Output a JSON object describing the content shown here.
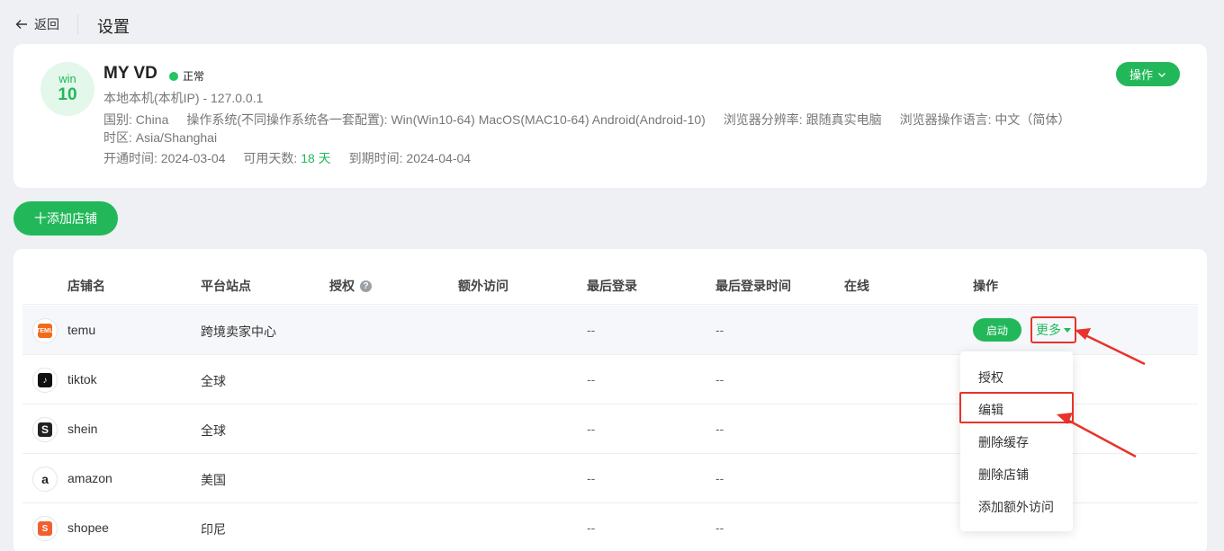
{
  "header": {
    "back_label": "返回",
    "title": "设置"
  },
  "device": {
    "os_label": "win",
    "os_version": "10",
    "name": "MY VD",
    "status": "正常",
    "status_color": "#22c55e",
    "address": "本地本机(本机IP) - 127.0.0.1",
    "country": "国别: China",
    "os_config": "操作系统(不同操作系统各一套配置): Win(Win10-64) MacOS(MAC10-64) Android(Android-10)",
    "resolution": "浏览器分辨率: 跟随真实电脑",
    "language": "浏览器操作语言: 中文（简体）",
    "timezone": "时区: Asia/Shanghai",
    "open_date": "开通时间: 2024-03-04",
    "days_label": "可用天数:",
    "days_value": "18 天",
    "expire_date": "到期时间: 2024-04-04",
    "ops_button": "操作"
  },
  "add_shop_button": "十添加店铺",
  "table": {
    "columns": [
      "店铺名",
      "平台站点",
      "授权",
      "额外访问",
      "最后登录",
      "最后登录时间",
      "在线",
      "操作"
    ],
    "rows": [
      {
        "name": "temu",
        "site": "跨境卖家中心",
        "last_login": "--",
        "last_login_time": "--",
        "logo": "temu-logo-icon"
      },
      {
        "name": "tiktok",
        "site": "全球",
        "last_login": "--",
        "last_login_time": "--",
        "logo": "tiktok-logo-icon"
      },
      {
        "name": "shein",
        "site": "全球",
        "last_login": "--",
        "last_login_time": "--",
        "logo": "shein-logo-icon"
      },
      {
        "name": "amazon",
        "site": "美国",
        "last_login": "--",
        "last_login_time": "--",
        "logo": "amazon-logo-icon"
      },
      {
        "name": "shopee",
        "site": "印尼",
        "last_login": "--",
        "last_login_time": "--",
        "logo": "shopee-logo-icon"
      }
    ],
    "start_label": "启动",
    "more_label": "更多"
  },
  "more_menu": {
    "items": [
      "授权",
      "编辑",
      "删除缓存",
      "删除店铺",
      "添加额外访问"
    ]
  },
  "colors": {
    "accent": "#22b85a",
    "highlight_red": "#e8322b"
  }
}
